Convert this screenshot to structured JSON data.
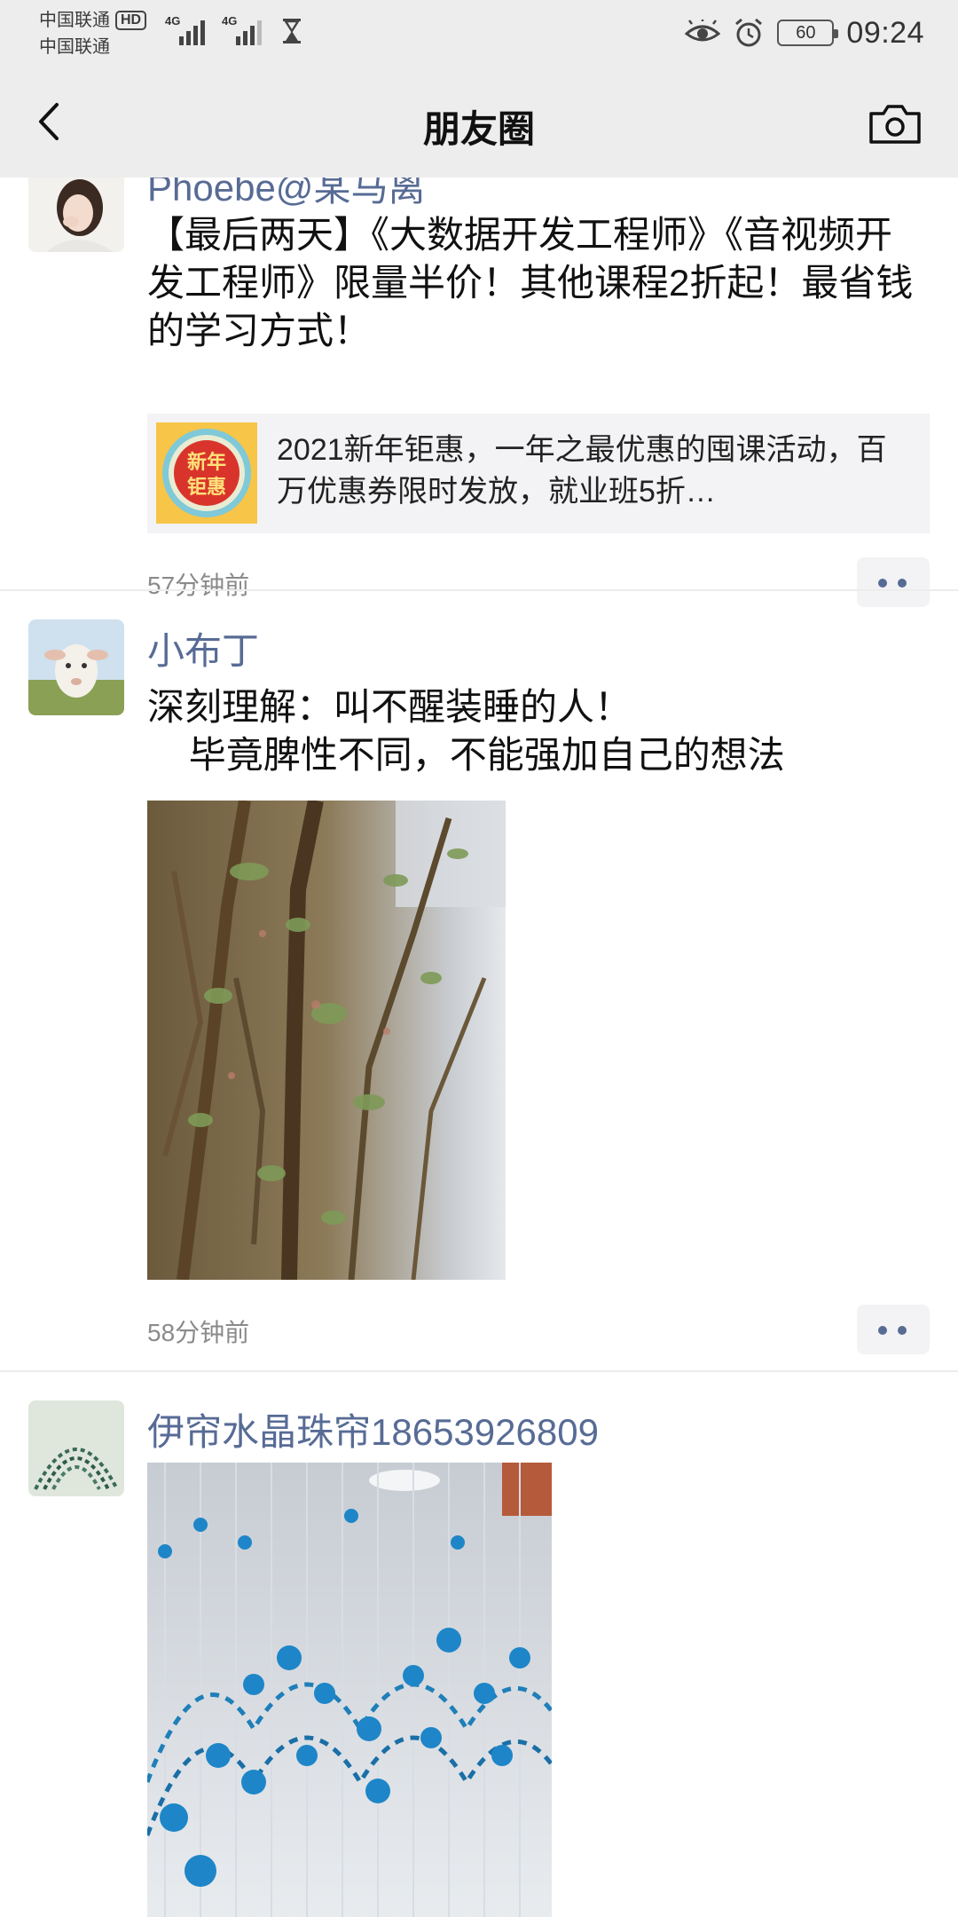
{
  "status_bar": {
    "carrier1": "中国联通",
    "hd": "HD",
    "carrier2": "中国联通",
    "net1": "4G",
    "net2": "4G",
    "battery": "60",
    "time": "09:24"
  },
  "nav": {
    "title": "朋友圈"
  },
  "posts": [
    {
      "name": "Phoebe@某马离",
      "content": "【最后两天】《大数据开发工程师》《音视频开发工程师》限量半价！其他课程2折起！最省钱的学习方式！",
      "link_thumb_text": "新年钜惠",
      "link_text": "2021新年钜惠，一年之最优惠的囤课活动，百万优惠券限时发放，就业班5折…",
      "time": "57分钟前"
    },
    {
      "name": "小布丁",
      "content": "深刻理解：叫不醒装睡的人！\n    毕竟脾性不同，不能强加自己的想法",
      "time": "58分钟前"
    },
    {
      "name": "伊帘水晶珠帘18653926809"
    }
  ],
  "colors": {
    "name_link": "#576b95",
    "bar_bg": "#ededed"
  }
}
